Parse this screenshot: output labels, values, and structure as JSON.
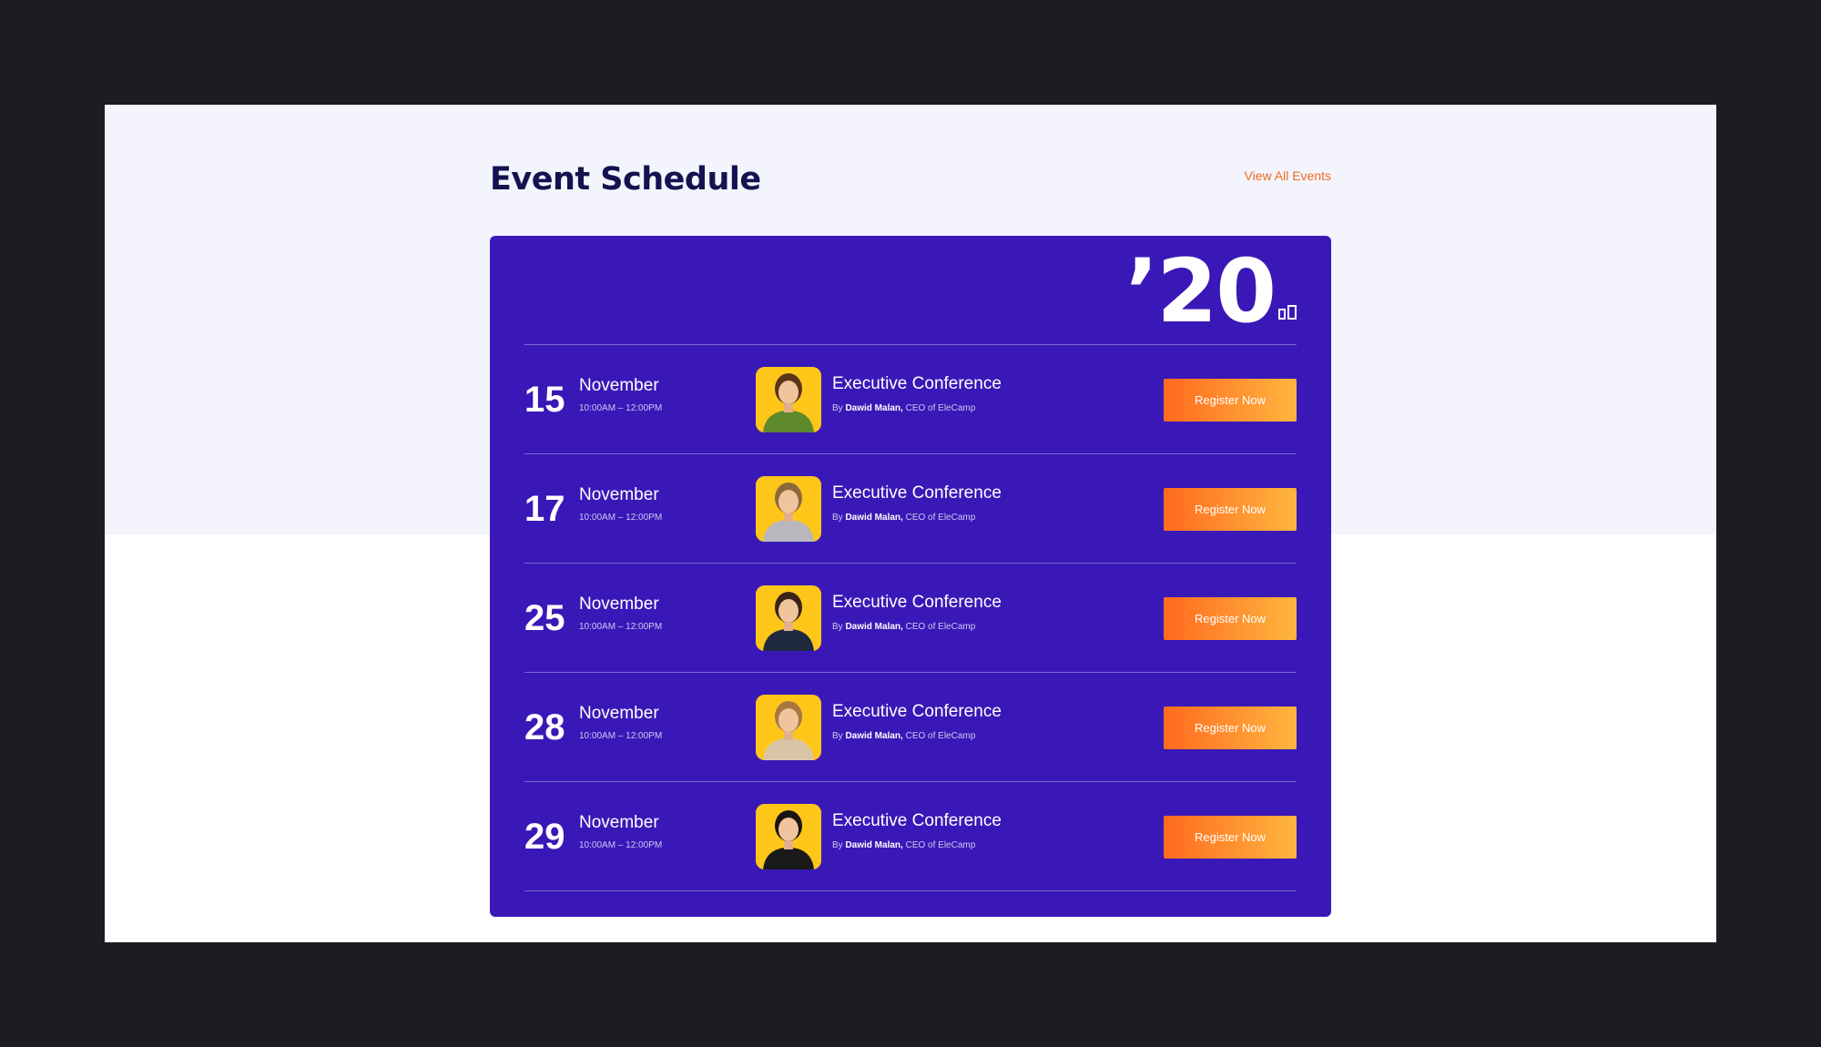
{
  "header": {
    "title": "Event Schedule",
    "view_all_label": "View All Events"
  },
  "year": "’20",
  "events": [
    {
      "day": "15",
      "month": "November",
      "time": "10:00AM – 12:00PM",
      "title": "Executive Conference",
      "by_prefix": "By",
      "speaker": "Dawid Malan,",
      "role": "CEO of EleCamp",
      "register_label": "Register Now",
      "avatar": {
        "shirt": "#5e8a2d",
        "hair": "#5a3418"
      }
    },
    {
      "day": "17",
      "month": "November",
      "time": "10:00AM – 12:00PM",
      "title": "Executive Conference",
      "by_prefix": "By",
      "speaker": "Dawid Malan,",
      "role": "CEO of EleCamp",
      "register_label": "Register Now",
      "avatar": {
        "shirt": "#b8b8bc",
        "hair": "#8a6a3a"
      }
    },
    {
      "day": "25",
      "month": "November",
      "time": "10:00AM – 12:00PM",
      "title": "Executive Conference",
      "by_prefix": "By",
      "speaker": "Dawid Malan,",
      "role": "CEO of EleCamp",
      "register_label": "Register Now",
      "avatar": {
        "shirt": "#1f2a3f",
        "hair": "#3a2418"
      }
    },
    {
      "day": "28",
      "month": "November",
      "time": "10:00AM – 12:00PM",
      "title": "Executive Conference",
      "by_prefix": "By",
      "speaker": "Dawid Malan,",
      "role": "CEO of EleCamp",
      "register_label": "Register Now",
      "avatar": {
        "shirt": "#d9c6a8",
        "hair": "#a87840"
      }
    },
    {
      "day": "29",
      "month": "November",
      "time": "10:00AM – 12:00PM",
      "title": "Executive Conference",
      "by_prefix": "By",
      "speaker": "Dawid Malan,",
      "role": "CEO of EleCamp",
      "register_label": "Register Now",
      "avatar": {
        "shirt": "#1a1a1a",
        "hair": "#1a1410"
      }
    }
  ],
  "colors": {
    "card_bg": "#3a18b7",
    "accent_orange": "#f26a22",
    "title_navy": "#14124f",
    "avatar_yellow": "#ffc107"
  }
}
